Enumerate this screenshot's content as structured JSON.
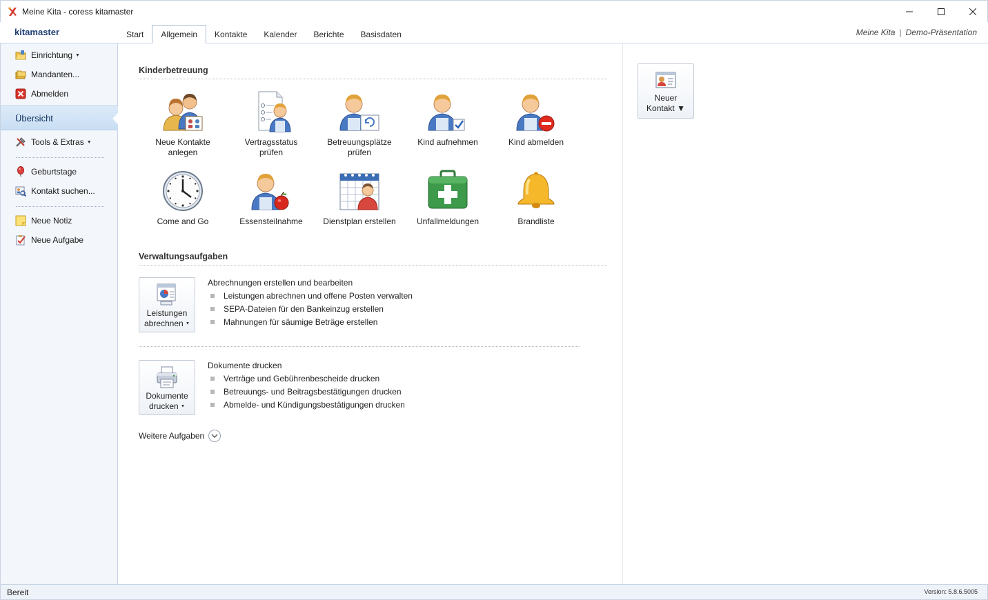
{
  "window": {
    "title": "Meine Kita - coress kitamaster",
    "controls": [
      "minimize-icon",
      "maximize-icon",
      "close-icon"
    ]
  },
  "brand": "kitamaster",
  "tabs": [
    {
      "label": "Start"
    },
    {
      "label": "Allgemein",
      "active": true
    },
    {
      "label": "Kontakte"
    },
    {
      "label": "Kalender"
    },
    {
      "label": "Berichte"
    },
    {
      "label": "Basisdaten"
    }
  ],
  "header_right": {
    "kita": "Meine Kita",
    "separator": "|",
    "mode": "Demo-Präsentation"
  },
  "sidebar": {
    "items": [
      {
        "label": "Einrichtung",
        "icon": "folder-icon",
        "dropdown": true
      },
      {
        "label": "Mandanten...",
        "icon": "folders-icon"
      },
      {
        "label": "Abmelden",
        "icon": "logout-icon"
      },
      {
        "label": "Übersicht",
        "selected": true
      },
      {
        "label": "Tools & Extras",
        "icon": "tools-icon",
        "dropdown": true
      },
      {
        "label": "Geburtstage",
        "icon": "balloon-icon"
      },
      {
        "label": "Kontakt suchen...",
        "icon": "contact-search-icon"
      },
      {
        "label": "Neue Notiz",
        "icon": "note-icon"
      },
      {
        "label": "Neue Aufgabe",
        "icon": "task-icon"
      }
    ]
  },
  "kinderbetreuung": {
    "title": "Kinderbetreuung",
    "tiles": [
      {
        "line1": "Neue Kontakte",
        "line2": "anlegen",
        "icon": "new-contacts-icon"
      },
      {
        "line1": "Vertragsstatus",
        "line2": "prüfen",
        "icon": "contract-status-icon"
      },
      {
        "line1": "Betreuungsplätze",
        "line2": "prüfen",
        "icon": "care-places-icon"
      },
      {
        "line1": "Kind aufnehmen",
        "line2": "",
        "icon": "child-admit-icon"
      },
      {
        "line1": "Kind abmelden",
        "line2": "",
        "icon": "child-deregister-icon"
      },
      {
        "line1": "Come and Go",
        "line2": "",
        "icon": "clock-icon"
      },
      {
        "line1": "Essensteilnahme",
        "line2": "",
        "icon": "meal-icon"
      },
      {
        "line1": "Dienstplan erstellen",
        "line2": "",
        "icon": "duty-roster-icon"
      },
      {
        "line1": "Unfallmeldungen",
        "line2": "",
        "icon": "first-aid-icon"
      },
      {
        "line1": "Brandliste",
        "line2": "",
        "icon": "bell-icon"
      }
    ]
  },
  "verwaltung": {
    "title": "Verwaltungsaufgaben",
    "groups": [
      {
        "button_line1": "Leistungen",
        "button_line2": "abrechnen",
        "heading": "Abrechnungen erstellen und bearbeiten",
        "bullets": [
          "Leistungen abrechnen und offene Posten verwalten",
          "SEPA-Dateien für den Bankeinzug erstellen",
          "Mahnungen für säumige Beträge erstellen"
        ]
      },
      {
        "button_line1": "Dokumente",
        "button_line2": "drucken",
        "heading": "Dokumente drucken",
        "bullets": [
          "Verträge und Gebührenbescheide drucken",
          "Betreuungs- und Beitragsbestätigungen drucken",
          "Abmelde- und Kündigungsbestätigungen drucken"
        ]
      }
    ],
    "more": "Weitere Aufgaben"
  },
  "right_panel": {
    "button_line1": "Neuer",
    "button_line2": "Kontakt"
  },
  "statusbar": {
    "left": "Bereit",
    "version": "Version: 5.8.6.5005"
  }
}
